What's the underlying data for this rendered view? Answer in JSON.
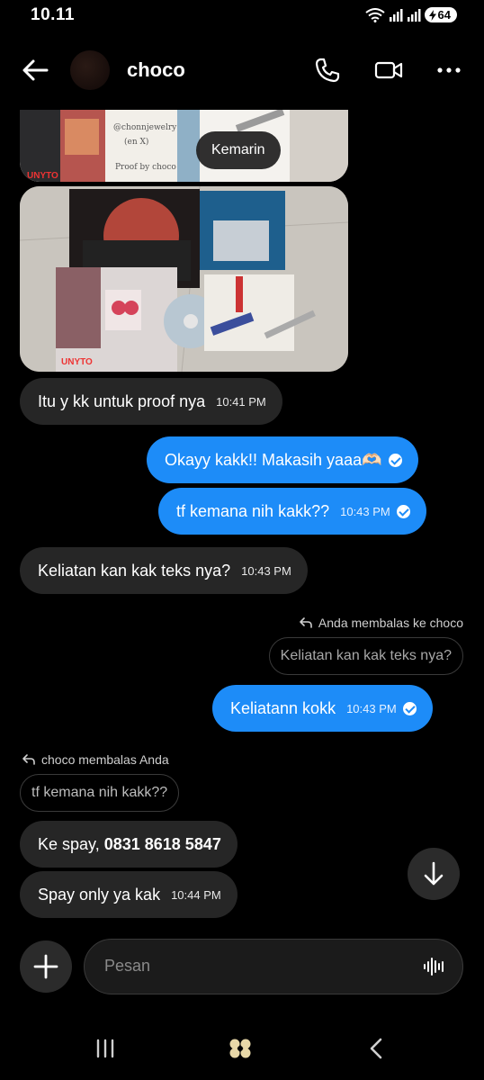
{
  "status_bar": {
    "time": "10.11",
    "battery": "64"
  },
  "header": {
    "contact_name": "choco"
  },
  "date_chip": "Kemarin",
  "messages": [
    {
      "text": "Itu y kk untuk proof nya",
      "time": "10:41 PM"
    },
    {
      "text": "Okayy kakk!! Makasih yaaa🫶🏻"
    },
    {
      "text": "tf kemana nih kakk??",
      "time": "10:43 PM"
    },
    {
      "text": "Keliatan kan kak teks nya?",
      "time": "10:43 PM"
    },
    {
      "text": "Keliatann kokk",
      "time": "10:43 PM"
    },
    {
      "text_prefix": "Ke spay, ",
      "text_bold": "0831 8618 5847"
    },
    {
      "text": "Spay only ya kak",
      "time": "10:44 PM"
    }
  ],
  "reply1": {
    "label": "Anda membalas ke choco",
    "quote": "Keliatan kan kak teks nya?"
  },
  "reply2": {
    "label": "choco membalas Anda",
    "quote": "tf kemana nih kakk??"
  },
  "photo1_texts": {
    "handle": "@chonnjewelry",
    "sub": "(en X)",
    "proof": "Proof by choco"
  },
  "composer": {
    "placeholder": "Pesan"
  },
  "colors": {
    "sent_bubble": "#1d8cf8",
    "received_bubble": "#262626",
    "background": "#000000"
  },
  "icons": [
    "back-arrow-icon",
    "phone-icon",
    "video-icon",
    "more-icon",
    "arrow-down-icon",
    "plus-icon",
    "voice-wave-icon"
  ]
}
